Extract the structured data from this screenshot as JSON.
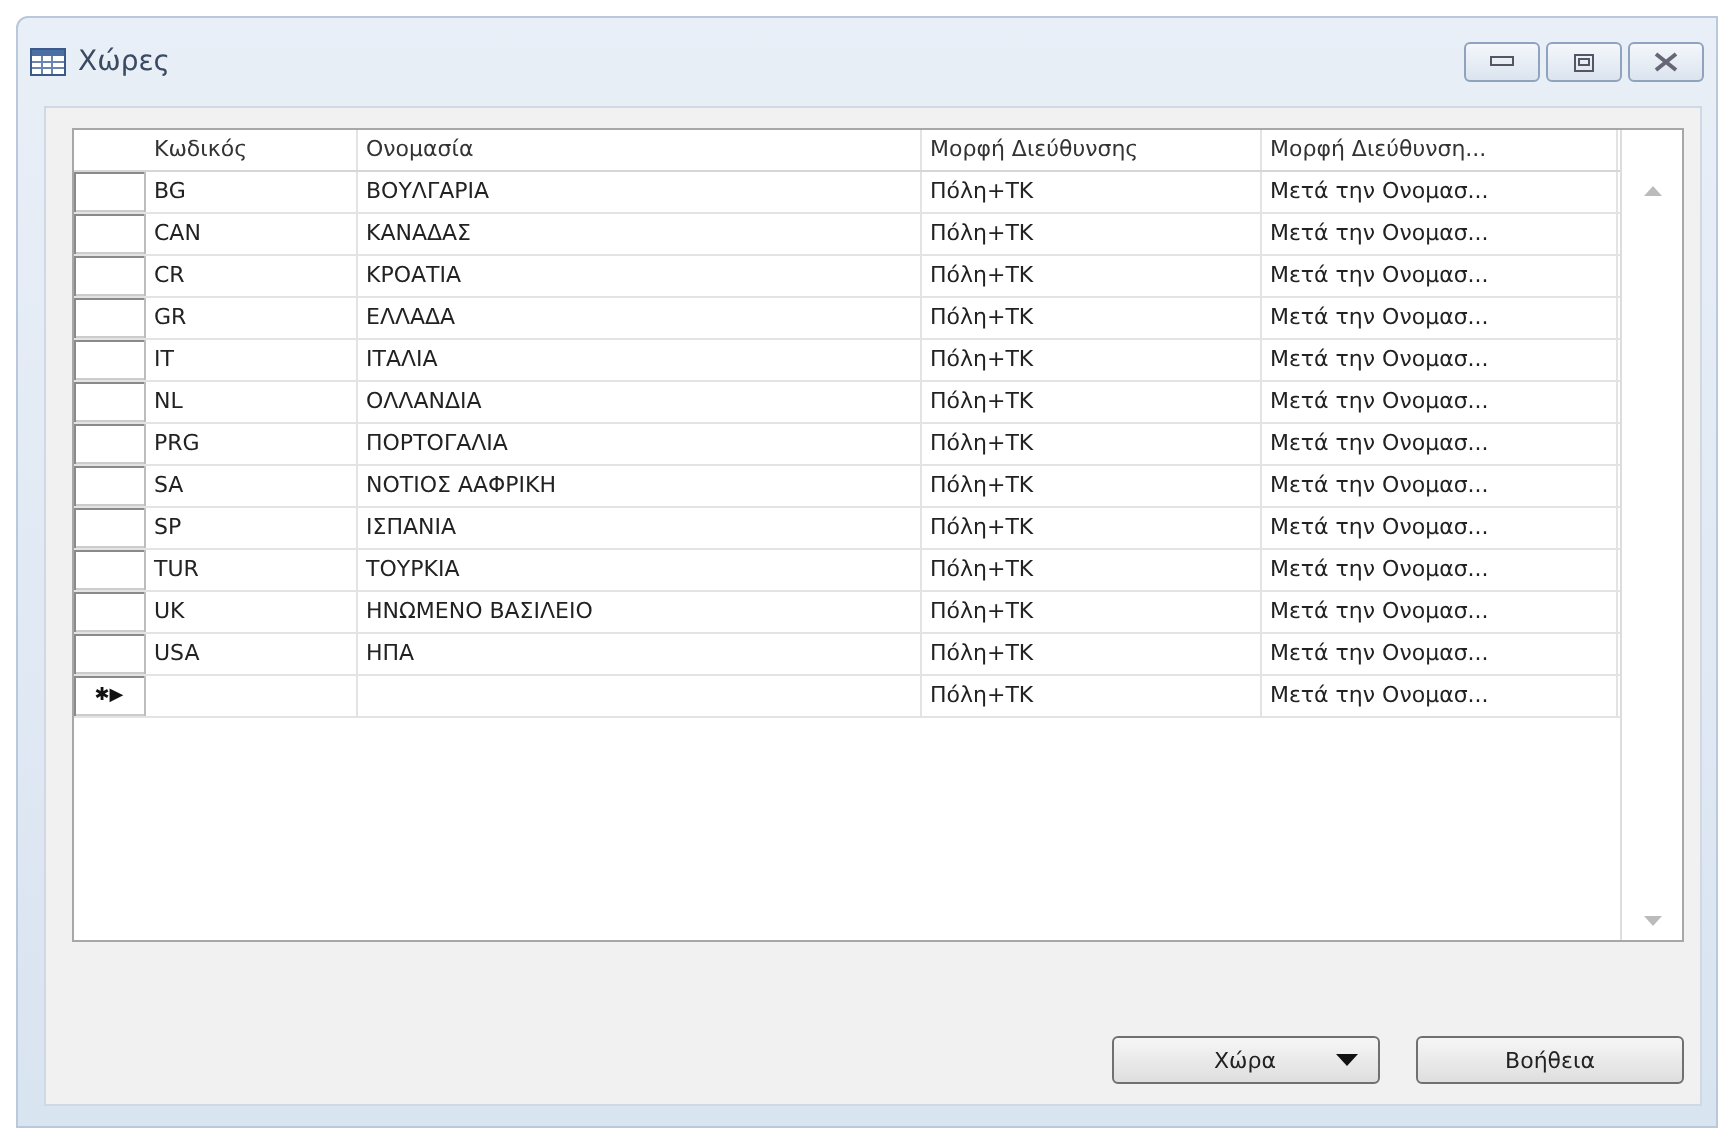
{
  "window": {
    "title": "Χώρες"
  },
  "table": {
    "columns": [
      "Κωδικός",
      "Ονομασία",
      "Μορφή Διεύθυνσης",
      "Μορφή Διεύθυνση..."
    ],
    "rows": [
      {
        "kind": "data",
        "cells": [
          "BG",
          "ΒΟΥΛΓΑΡΙΑ",
          "Πόλη+ΤΚ",
          "Μετά την Ονομασ..."
        ]
      },
      {
        "kind": "data",
        "cells": [
          "CAN",
          "ΚΑΝΑΔΑΣ",
          "Πόλη+ΤΚ",
          "Μετά την Ονομασ..."
        ]
      },
      {
        "kind": "data",
        "cells": [
          "CR",
          "ΚΡΟΑΤΙΑ",
          "Πόλη+ΤΚ",
          "Μετά την Ονομασ..."
        ]
      },
      {
        "kind": "data",
        "cells": [
          "GR",
          "ΕΛΛΑΔΑ",
          "Πόλη+ΤΚ",
          "Μετά την Ονομασ..."
        ]
      },
      {
        "kind": "data",
        "cells": [
          "IT",
          "ΙΤΑΛΙΑ",
          "Πόλη+ΤΚ",
          "Μετά την Ονομασ..."
        ]
      },
      {
        "kind": "data",
        "cells": [
          "NL",
          "ΟΛΛΑΝΔΙΑ",
          "Πόλη+ΤΚ",
          "Μετά την Ονομασ..."
        ]
      },
      {
        "kind": "data",
        "cells": [
          "PRG",
          "ΠΟΡΤΟΓΑΛΙΑ",
          "Πόλη+ΤΚ",
          "Μετά την Ονομασ..."
        ]
      },
      {
        "kind": "data",
        "cells": [
          "SA",
          "ΝΟΤΙΟΣ ΑΑΦΡΙΚΗ",
          "Πόλη+ΤΚ",
          "Μετά την Ονομασ..."
        ]
      },
      {
        "kind": "data",
        "cells": [
          "SP",
          "ΙΣΠΑΝΙΑ",
          "Πόλη+ΤΚ",
          "Μετά την Ονομασ..."
        ]
      },
      {
        "kind": "data",
        "cells": [
          "TUR",
          "ΤΟΥΡΚΙΑ",
          "Πόλη+ΤΚ",
          "Μετά την Ονομασ..."
        ]
      },
      {
        "kind": "data",
        "cells": [
          "UK",
          "ΗΝΩΜΕΝΟ ΒΑΣΙΛΕΙΟ",
          "Πόλη+ΤΚ",
          "Μετά την Ονομασ..."
        ]
      },
      {
        "kind": "data",
        "cells": [
          "USA",
          "ΗΠΑ",
          "Πόλη+ΤΚ",
          "Μετά την Ονομασ..."
        ]
      },
      {
        "kind": "new",
        "marker": "✱▶",
        "cells": [
          "",
          "",
          "Πόλη+ΤΚ",
          "Μετά την Ονομασ..."
        ]
      }
    ]
  },
  "buttons": [
    {
      "kind": "dropdown",
      "label": "Χώρα"
    },
    {
      "kind": "plain",
      "label": "Βοήθεια"
    }
  ]
}
